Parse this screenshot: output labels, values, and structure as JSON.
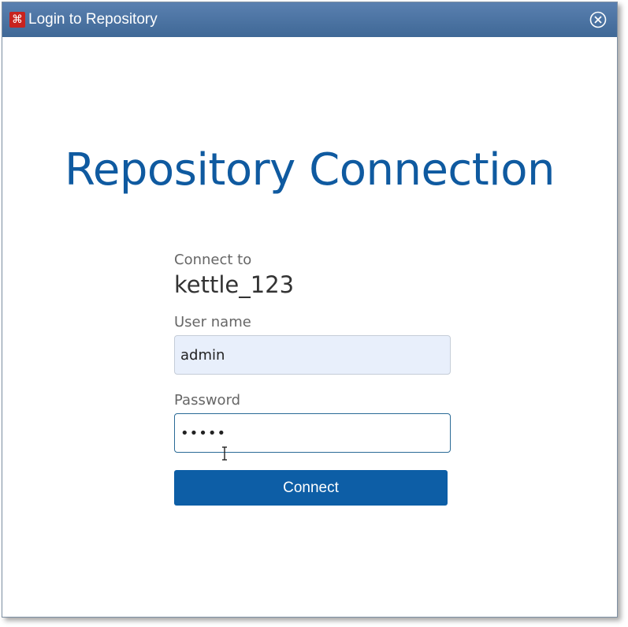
{
  "window": {
    "title": "Login to Repository",
    "app_icon": "pentaho-app-icon",
    "close_icon": "close-circle-icon"
  },
  "main": {
    "heading": "Repository Connection",
    "connect_to_label": "Connect to",
    "repository_name": "kettle_123",
    "username_label": "User name",
    "username_value": "admin",
    "password_label": "Password",
    "password_value": "•••••",
    "connect_button": "Connect"
  },
  "colors": {
    "titlebar": "#4a73a3",
    "heading": "#0f5aa0",
    "button": "#0d5ea6",
    "username_bg": "#e8effb",
    "password_border": "#2a6a96"
  }
}
